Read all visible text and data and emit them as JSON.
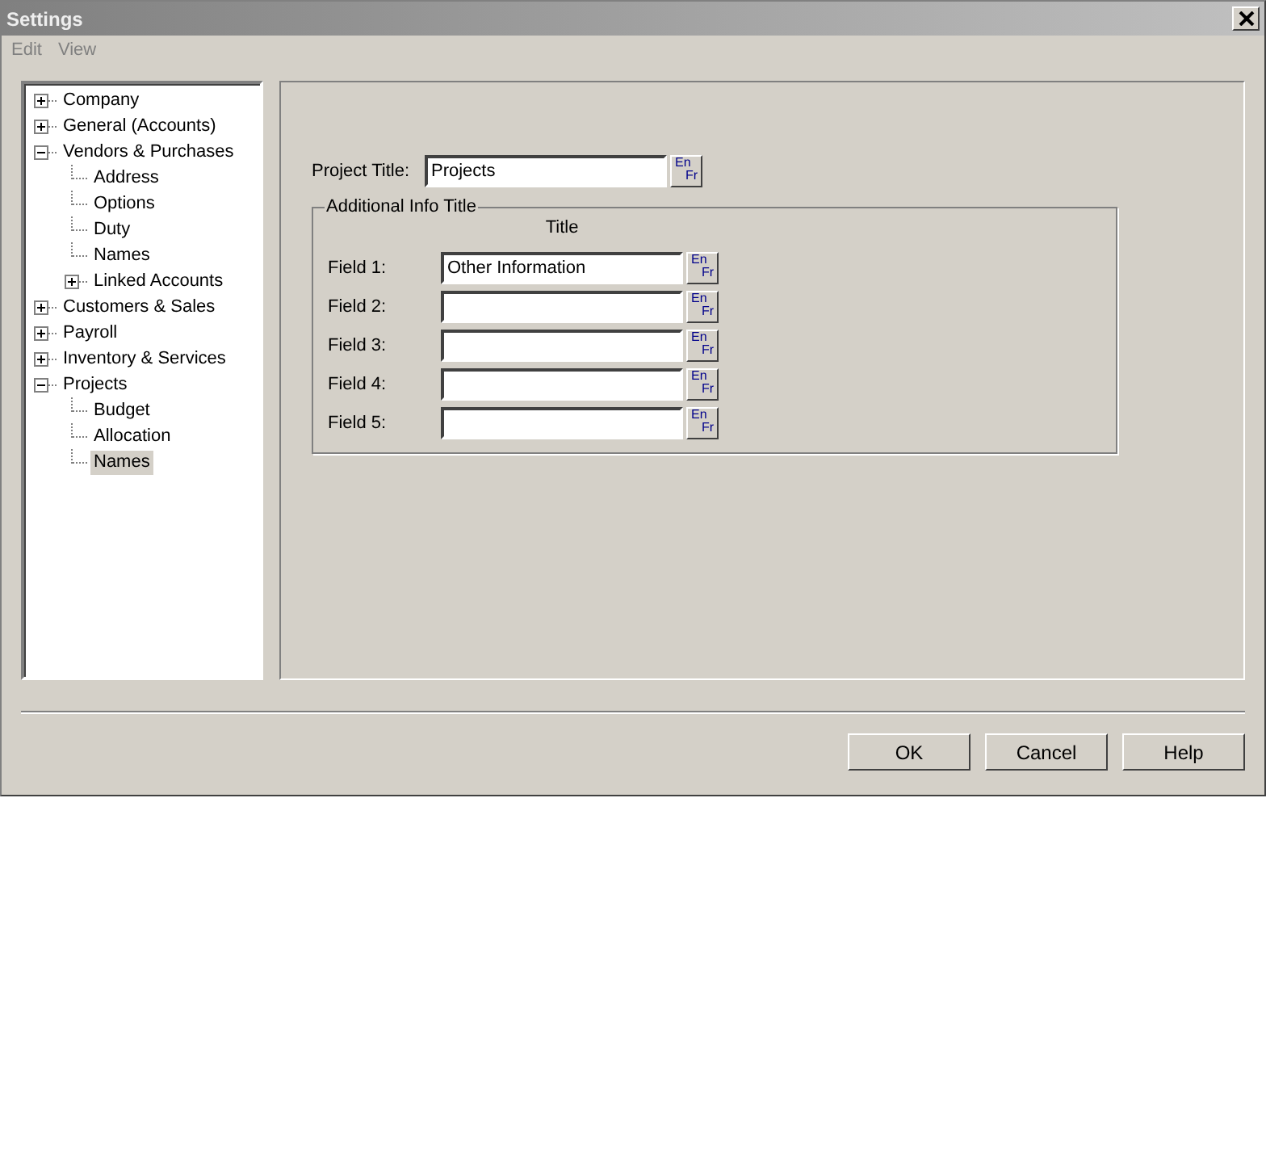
{
  "window": {
    "title": "Settings"
  },
  "menu": [
    {
      "label": "Edit",
      "disabled": true
    },
    {
      "label": "View",
      "disabled": true
    }
  ],
  "tree": [
    {
      "label": "Company",
      "expanded": false,
      "selected": false
    },
    {
      "label": "General (Accounts)",
      "expanded": false,
      "selected": false
    },
    {
      "label": "Vendors & Purchases",
      "expanded": true,
      "selected": false,
      "children": [
        {
          "label": "Address",
          "selected": false
        },
        {
          "label": "Options",
          "selected": false
        },
        {
          "label": "Duty",
          "selected": false
        },
        {
          "label": "Names",
          "selected": false
        },
        {
          "label": "Linked Accounts",
          "expanded": false,
          "selected": false
        }
      ]
    },
    {
      "label": "Customers & Sales",
      "expanded": false,
      "selected": false
    },
    {
      "label": "Payroll",
      "expanded": false,
      "selected": false
    },
    {
      "label": "Inventory & Services",
      "expanded": false,
      "selected": false
    },
    {
      "label": "Projects",
      "expanded": true,
      "selected": false,
      "children": [
        {
          "label": "Budget",
          "selected": false
        },
        {
          "label": "Allocation",
          "selected": false
        },
        {
          "label": "Names",
          "selected": true
        }
      ]
    }
  ],
  "project_title": {
    "label": "Project Title:",
    "value": "Projects",
    "lang": [
      "En",
      "Fr"
    ]
  },
  "additional_info": {
    "title": "Additional Info Title",
    "column": "Title",
    "fields": [
      {
        "label": "Field 1:",
        "value": "Other Information",
        "lang": [
          "En",
          "Fr"
        ]
      },
      {
        "label": "Field 2:",
        "lang": [
          "En",
          "Fr"
        ]
      },
      {
        "label": "Field 3:",
        "lang": [
          "En",
          "Fr"
        ]
      },
      {
        "label": "Field 4:",
        "lang": [
          "En",
          "Fr"
        ]
      },
      {
        "label": "Field 5:",
        "lang": [
          "En",
          "Fr"
        ]
      }
    ]
  },
  "buttons": [
    "OK",
    "Cancel",
    "Help"
  ]
}
